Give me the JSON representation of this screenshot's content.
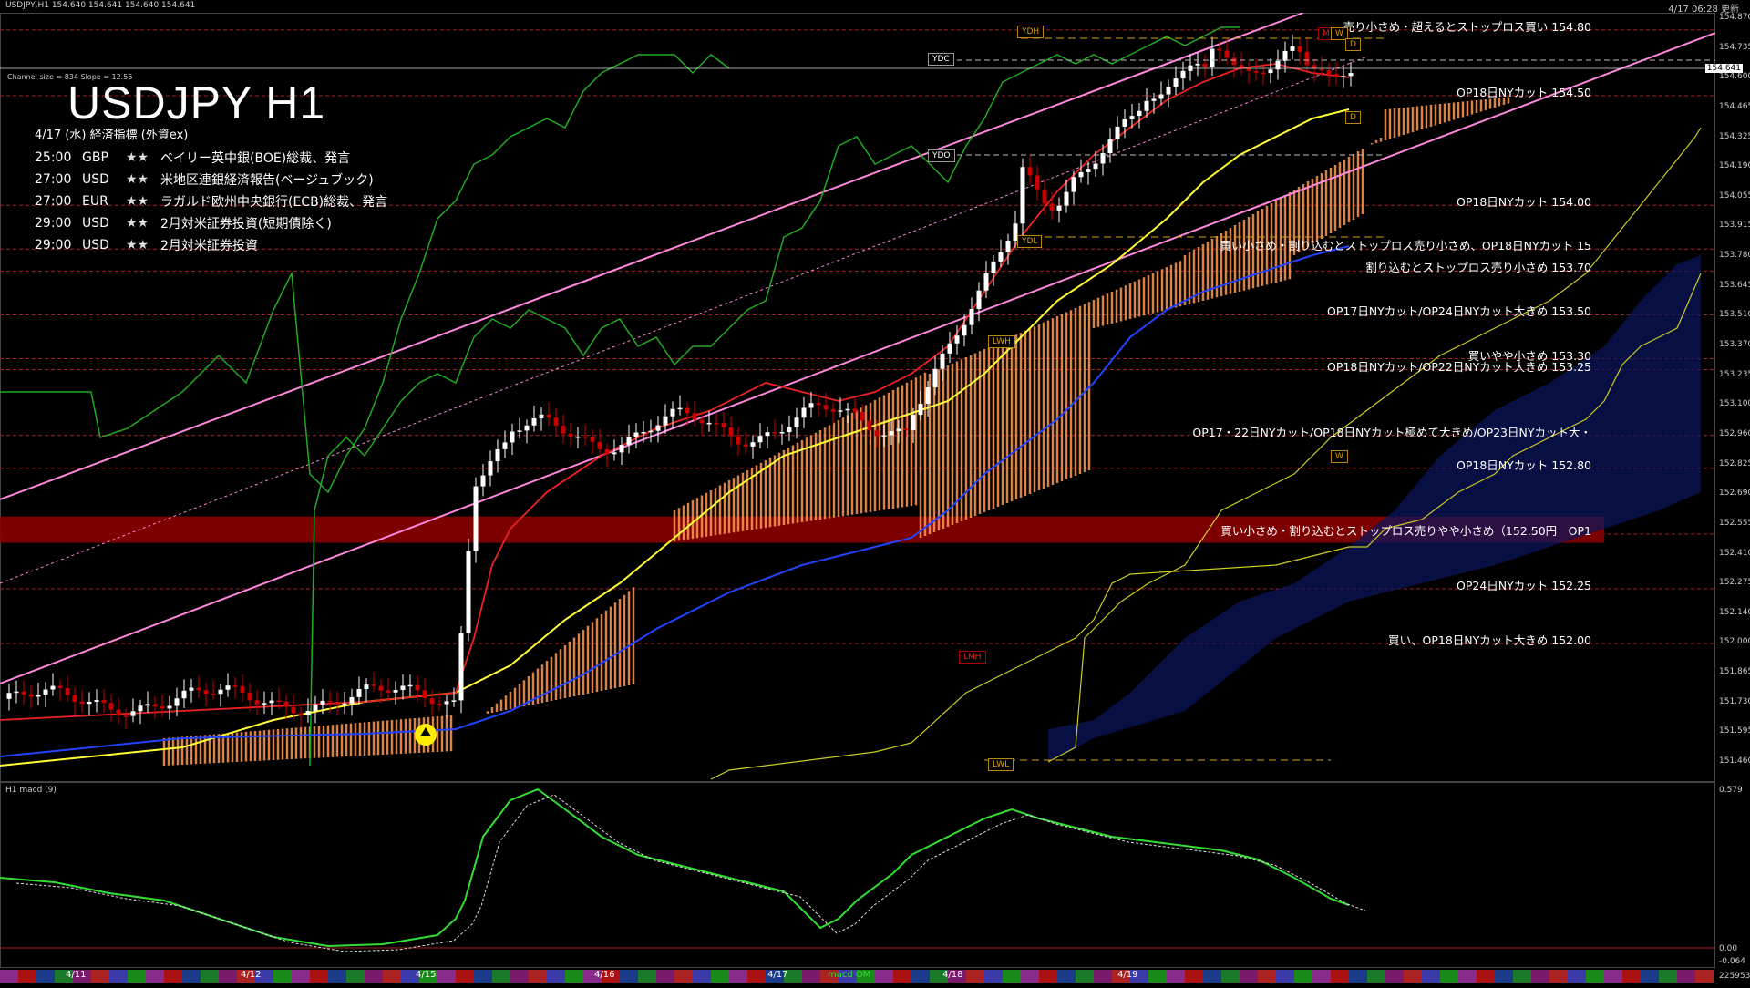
{
  "header": {
    "title_line": "USDJPY,H1  154.640 154.641 154.640 154.641",
    "updated": "4/17 06:28 更新"
  },
  "chart_title": "USDJPY H1",
  "channel_info": "Channel size = 834  Slope = 12.56",
  "events": {
    "heading": "4/17 (水) 経済指標 (外資ex)",
    "items": [
      {
        "time": "25:00",
        "ccy": "GBP",
        "stars": "★★",
        "text": "ベイリー英中銀(BOE)総裁、発言"
      },
      {
        "time": "27:00",
        "ccy": "USD",
        "stars": "★★",
        "text": "米地区連銀経済報告(ベージュブック)"
      },
      {
        "time": "27:00",
        "ccy": "EUR",
        "stars": "★★",
        "text": "ラガルド欧州中央銀行(ECB)総裁、発言"
      },
      {
        "time": "29:00",
        "ccy": "USD",
        "stars": "★★",
        "text": "2月対米証券投資(短期債除く)"
      },
      {
        "time": "29:00",
        "ccy": "USD",
        "stars": "★★",
        "text": "2月対米証券投資"
      }
    ]
  },
  "levels": [
    {
      "price": 154.8,
      "text": "売り小さめ・超えるとストップロス買い 154.80"
    },
    {
      "price": 154.5,
      "text": "OP18日NYカット 154.50"
    },
    {
      "price": 154.0,
      "text": "OP18日NYカット 154.00"
    },
    {
      "price": 153.8,
      "text": "買い小さめ・割り込むとストップロス売り小さめ、OP18日NYカット 15"
    },
    {
      "price": 153.7,
      "text": "割り込むとストップロス売り小さめ 153.70"
    },
    {
      "price": 153.5,
      "text": "OP17日NYカット/OP24日NYカット大きめ 153.50"
    },
    {
      "price": 153.3,
      "text": "買いやや小さめ 153.30"
    },
    {
      "price": 153.25,
      "text": "OP18日NYカット/OP22日NYカット大きめ 153.25"
    },
    {
      "price": 152.95,
      "text": "OP17・22日NYカット/OP18日NYカット極めて大きめ/OP23日NYカット大・"
    },
    {
      "price": 152.8,
      "text": "OP18日NYカット 152.80"
    },
    {
      "price": 152.5,
      "text": "買い小さめ・割り込むとストップロス売りやや小さめ（152.50円　OP1"
    },
    {
      "price": 152.25,
      "text": "OP24日NYカット 152.25"
    },
    {
      "price": 152.0,
      "text": "買い、OP18日NYカット大きめ 152.00"
    }
  ],
  "price_axis": [
    "154.870",
    "154.735",
    "154.600",
    "154.465",
    "154.325",
    "154.190",
    "154.055",
    "153.915",
    "153.780",
    "153.645",
    "153.510",
    "153.370",
    "153.235",
    "153.100",
    "152.960",
    "152.825",
    "152.690",
    "152.555",
    "152.410",
    "152.275",
    "152.140",
    "152.000",
    "151.865",
    "151.730",
    "151.595",
    "151.460"
  ],
  "current_price": "154.641",
  "markers": {
    "ydh": "YDH",
    "ydc": "YDC",
    "ydo": "YDO",
    "ydl": "YDL",
    "lwh": "LWH",
    "lwl": "LWL",
    "lmh": "LMH",
    "m": "M",
    "w": "W",
    "d": "D"
  },
  "macd": {
    "label": "H1  macd (9)",
    "axis": [
      "0.579",
      "0.00",
      "-0.064"
    ],
    "bottom_axis": "225953"
  },
  "dates": [
    "4/11",
    "4/12",
    "4/15",
    "4/16",
    "4/17",
    "4/18",
    "4/19"
  ],
  "macd_tag": "macd OM",
  "colors": {
    "bull": "#ffffff",
    "bear": "#cc0000",
    "cloud": "#ff9955",
    "cloud_dots": "#2233aa",
    "ma_yellow": "#ffff33",
    "ma_blue": "#2244ff",
    "channel": "#ff88dd",
    "lagging": "#22aa22",
    "level_line": "#aa2222",
    "band": "#8b0000"
  }
}
